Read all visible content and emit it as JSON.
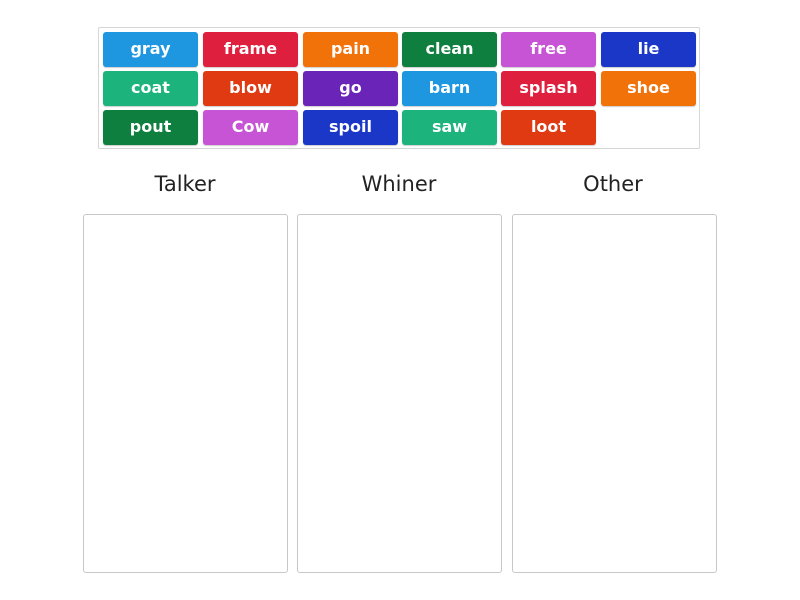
{
  "tiles": [
    {
      "label": "gray",
      "color": "#1e96e0"
    },
    {
      "label": "frame",
      "color": "#de1f3e"
    },
    {
      "label": "pain",
      "color": "#f2720a"
    },
    {
      "label": "clean",
      "color": "#0f7f3f"
    },
    {
      "label": "free",
      "color": "#c654d4"
    },
    {
      "label": "lie",
      "color": "#1a37c8"
    },
    {
      "label": "coat",
      "color": "#1cb47c"
    },
    {
      "label": "blow",
      "color": "#df3a12"
    },
    {
      "label": "go",
      "color": "#6a24b8"
    },
    {
      "label": "barn",
      "color": "#1e96e0"
    },
    {
      "label": "splash",
      "color": "#de1f3e"
    },
    {
      "label": "shoe",
      "color": "#f2720a"
    },
    {
      "label": "pout",
      "color": "#0f7f3f"
    },
    {
      "label": "Cow",
      "color": "#c654d4"
    },
    {
      "label": "spoil",
      "color": "#1a37c8"
    },
    {
      "label": "saw",
      "color": "#1cb47c"
    },
    {
      "label": "loot",
      "color": "#df3a12"
    }
  ],
  "groups": [
    {
      "label": "Talker"
    },
    {
      "label": "Whiner"
    },
    {
      "label": "Other"
    }
  ]
}
